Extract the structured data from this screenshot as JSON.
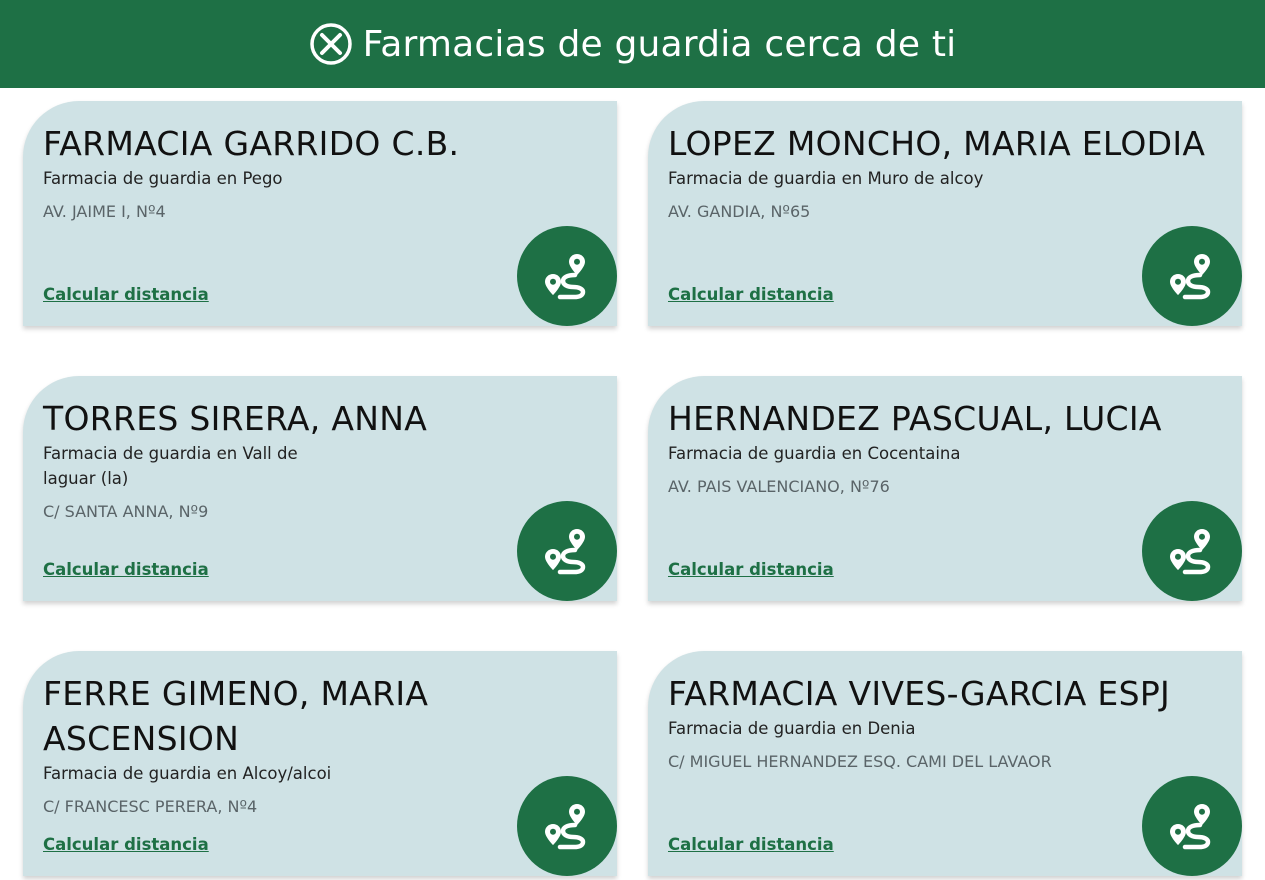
{
  "header": {
    "title": "Farmacias de guardia cerca de ti",
    "icon": "close-circle-icon"
  },
  "colors": {
    "brand": "#1e7045",
    "card_bg": "#cfe2e5"
  },
  "link_label": "Calcular distancia",
  "route_icon": "route-map-pin-icon",
  "pharmacies": [
    {
      "name": "FARMACIA GARRIDO C.B.",
      "subtitle": "Farmacia de guardia en Pego",
      "address": "AV. JAIME I, Nº4"
    },
    {
      "name": "LOPEZ MONCHO, MARIA ELODIA",
      "subtitle": "Farmacia de guardia en Muro de alcoy",
      "address": "AV. GANDIA, Nº65"
    },
    {
      "name": "TORRES SIRERA, ANNA",
      "subtitle": "Farmacia de guardia en Vall de laguar (la)",
      "address": "C/ SANTA ANNA, Nº9"
    },
    {
      "name": "HERNANDEZ PASCUAL, LUCIA",
      "subtitle": "Farmacia de guardia en Cocentaina",
      "address": "AV. PAIS VALENCIANO, Nº76"
    },
    {
      "name": "FERRE GIMENO, MARIA ASCENSION",
      "subtitle": "Farmacia de guardia en Alcoy/alcoi",
      "address": "C/ FRANCESC PERERA, Nº4"
    },
    {
      "name": "FARMACIA VIVES-GARCIA ESPJ",
      "subtitle": "Farmacia de guardia en Denia",
      "address": "C/ MIGUEL HERNANDEZ ESQ. CAMI DEL LAVAOR"
    }
  ]
}
